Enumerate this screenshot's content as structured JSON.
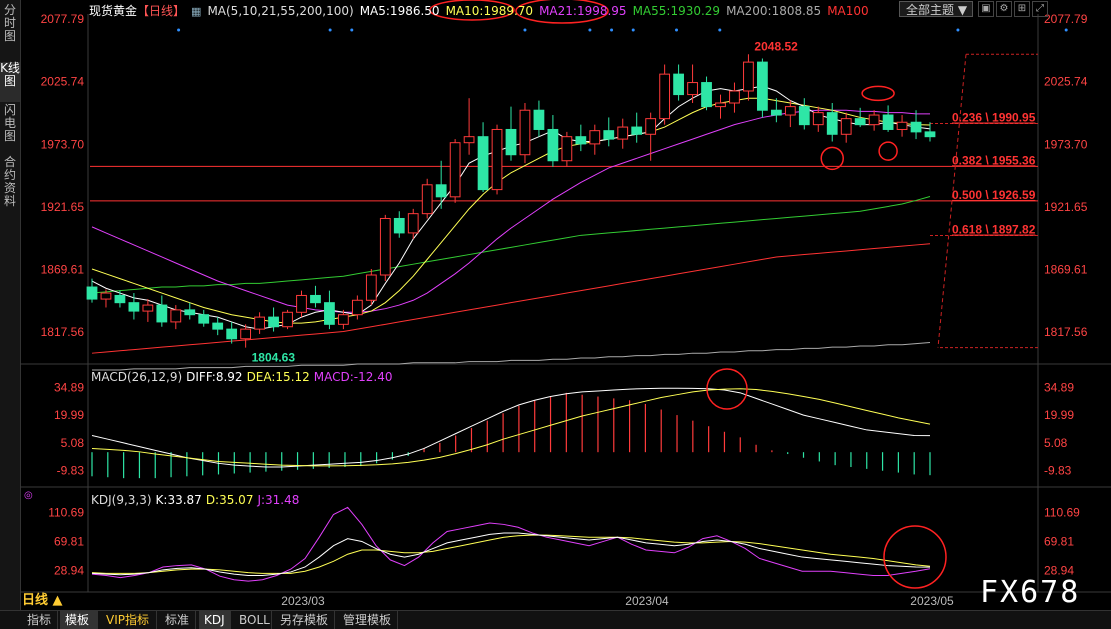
{
  "left_tabs": [
    "分时图",
    "K线图",
    "闪电图",
    "合约资料"
  ],
  "header": {
    "symbol": "现货黄金",
    "period_tag": "【日线】",
    "ma_params": "MA(5,10,21,55,200,100)",
    "ma5": "MA5:1986.50",
    "ma10": "MA10:1989.70",
    "ma21": "MA21:1998.95",
    "ma55": "MA55:1930.29",
    "ma200": "MA200:1808.85",
    "ma100": "MA100",
    "theme": "全部主题"
  },
  "colors": {
    "up": "#ff3b3b",
    "down": "#2ee6a6",
    "ma5": "#ffffff",
    "ma10": "#ffff55",
    "ma21": "#e040fb",
    "ma55": "#33cc33",
    "ma200": "#aaaaaa",
    "ma100": "#ff3333",
    "axis_label": "#ff4444",
    "circle": "#ff2222"
  },
  "price_axis": [
    "2077.79",
    "2025.74",
    "1973.70",
    "1921.65",
    "1869.61",
    "1817.56"
  ],
  "price_annotations": {
    "high": "2048.52",
    "low": "1804.63"
  },
  "fib_levels": [
    {
      "label": "0.236 \\ 1990.95",
      "price": 1990.95
    },
    {
      "label": "0.382 \\ 1955.36",
      "price": 1955.36
    },
    {
      "label": "0.500 \\ 1926.59",
      "price": 1926.59
    },
    {
      "label": "0.618 \\ 1897.82",
      "price": 1897.82
    }
  ],
  "macd": {
    "params": "MACD(26,12,9)",
    "diff": "DIFF:8.92",
    "dea": "DEA:15.12",
    "macd": "MACD:-12.40",
    "axis": [
      "34.89",
      "19.99",
      "5.08",
      "-9.83"
    ],
    "hist": [
      -13,
      -13.5,
      -14,
      -14,
      -14,
      -13.5,
      -13,
      -12.5,
      -12,
      -11.5,
      -11,
      -10.5,
      -10,
      -9.5,
      -9,
      -8.5,
      -8,
      -7.5,
      -6,
      -4,
      -2,
      2,
      5,
      9,
      13,
      17,
      21,
      25,
      28,
      30,
      32,
      31,
      30,
      29,
      28,
      26,
      23,
      20,
      17,
      14,
      11,
      8,
      4,
      1,
      -1,
      -3,
      -5,
      -7,
      -8,
      -9,
      -10,
      -11,
      -12,
      -12.4
    ],
    "diff_line": [
      9,
      7,
      5,
      3,
      1,
      -1,
      -3,
      -4.5,
      -6,
      -7,
      -7.5,
      -8,
      -8,
      -7.5,
      -7,
      -6.5,
      -6,
      -5.5,
      -4.5,
      -3,
      -1,
      2,
      6,
      10,
      14,
      18,
      22,
      25.5,
      28,
      30,
      31.5,
      32.5,
      33,
      33.5,
      34,
      34.3,
      34.5,
      34.5,
      34.4,
      34.2,
      33.5,
      32,
      29,
      26,
      23,
      20,
      18,
      16,
      14,
      12,
      11,
      10,
      9,
      8.92
    ],
    "dea_line": [
      2,
      1.5,
      1,
      0.2,
      -1,
      -2,
      -3,
      -4,
      -5,
      -5.5,
      -6,
      -6.5,
      -7,
      -7.2,
      -7.4,
      -7.4,
      -7.3,
      -7.1,
      -6.8,
      -6.3,
      -5.5,
      -4.3,
      -2.8,
      -0.8,
      1.5,
      4,
      7,
      9.5,
      12,
      14.5,
      17,
      19.5,
      21.5,
      23.5,
      25.5,
      27.5,
      29.5,
      31,
      32.5,
      33.5,
      34,
      34.2,
      33.8,
      32.8,
      31.5,
      30,
      28.5,
      26.5,
      24.5,
      22.5,
      20.5,
      18.5,
      16.8,
      15.12
    ]
  },
  "kdj": {
    "params": "KDJ(9,3,3)",
    "k": "K:33.87",
    "d": "D:35.07",
    "j": "J:31.48",
    "axis": [
      "110.69",
      "69.81",
      "28.94"
    ],
    "k_line": [
      25,
      24,
      23,
      24,
      26,
      30,
      32,
      33,
      31,
      27,
      24,
      22,
      22,
      24,
      27,
      34,
      48,
      64,
      74,
      70,
      60,
      52,
      48,
      52,
      60,
      68,
      72,
      76,
      80,
      82,
      82,
      80,
      78,
      76,
      74,
      72,
      74,
      76,
      72,
      68,
      66,
      64,
      66,
      70,
      72,
      70,
      66,
      60,
      56,
      52,
      48,
      46,
      44,
      42,
      40,
      38,
      36,
      35,
      34,
      33.87
    ],
    "d_line": [
      26,
      25,
      25,
      25,
      26,
      28,
      30,
      31,
      31,
      30,
      28,
      26,
      25,
      25,
      25,
      28,
      34,
      42,
      52,
      58,
      58,
      56,
      54,
      54,
      56,
      60,
      64,
      68,
      72,
      76,
      78,
      79,
      79,
      78,
      77,
      76,
      76,
      76,
      75,
      73,
      71,
      69,
      68,
      68,
      69,
      70,
      69,
      67,
      64,
      61,
      58,
      55,
      52,
      50,
      48,
      46,
      43,
      40,
      37,
      35.07
    ],
    "j_line": [
      24,
      22,
      19,
      22,
      26,
      34,
      36,
      37,
      31,
      21,
      16,
      14,
      16,
      22,
      31,
      46,
      76,
      108,
      118,
      94,
      64,
      44,
      36,
      48,
      68,
      84,
      88,
      92,
      96,
      94,
      90,
      82,
      76,
      72,
      68,
      64,
      70,
      76,
      66,
      58,
      56,
      54,
      62,
      74,
      78,
      70,
      60,
      46,
      40,
      34,
      28,
      28,
      28,
      26,
      24,
      22,
      22,
      25,
      28,
      31.48
    ]
  },
  "time_axis": [
    "2023/03",
    "2023/04",
    "2023/05"
  ],
  "period_label": "日线 ▲",
  "bottom_tabs": [
    "指标",
    "模板",
    "VIP指标",
    "标准",
    "KDJ",
    "BOLL",
    "另存模板",
    "管理模板"
  ],
  "watermark": "FX678",
  "chart_data": {
    "type": "candlestick",
    "ylim": [
      1796,
      2082
    ],
    "ohlc": [
      [
        1855,
        1862,
        1842,
        1845
      ],
      [
        1845,
        1853,
        1838,
        1850
      ],
      [
        1848,
        1852,
        1838,
        1842
      ],
      [
        1842,
        1850,
        1828,
        1835
      ],
      [
        1835,
        1845,
        1826,
        1840
      ],
      [
        1840,
        1848,
        1822,
        1826
      ],
      [
        1826,
        1840,
        1820,
        1836
      ],
      [
        1836,
        1842,
        1828,
        1832
      ],
      [
        1832,
        1836,
        1822,
        1825
      ],
      [
        1825,
        1830,
        1815,
        1820
      ],
      [
        1820,
        1826,
        1808,
        1812
      ],
      [
        1812,
        1824,
        1804.63,
        1820
      ],
      [
        1820,
        1834,
        1816,
        1830
      ],
      [
        1830,
        1838,
        1818,
        1822
      ],
      [
        1822,
        1836,
        1820,
        1834
      ],
      [
        1834,
        1852,
        1830,
        1848
      ],
      [
        1848,
        1856,
        1838,
        1842
      ],
      [
        1842,
        1852,
        1820,
        1824
      ],
      [
        1824,
        1836,
        1820,
        1832
      ],
      [
        1832,
        1848,
        1828,
        1844
      ],
      [
        1844,
        1870,
        1840,
        1865
      ],
      [
        1865,
        1915,
        1860,
        1912
      ],
      [
        1912,
        1918,
        1896,
        1900
      ],
      [
        1900,
        1920,
        1895,
        1916
      ],
      [
        1916,
        1945,
        1912,
        1940
      ],
      [
        1940,
        1960,
        1920,
        1930
      ],
      [
        1930,
        1978,
        1925,
        1975
      ],
      [
        1975,
        2012,
        1965,
        1980
      ],
      [
        1980,
        1992,
        1934,
        1936
      ],
      [
        1936,
        1990,
        1932,
        1986
      ],
      [
        1986,
        2005,
        1960,
        1965
      ],
      [
        1965,
        2008,
        1958,
        2002
      ],
      [
        2002,
        2010,
        1980,
        1986
      ],
      [
        1986,
        1998,
        1955,
        1960
      ],
      [
        1960,
        1984,
        1955,
        1980
      ],
      [
        1980,
        1990,
        1968,
        1974
      ],
      [
        1974,
        1990,
        1965,
        1985
      ],
      [
        1985,
        1996,
        1972,
        1978
      ],
      [
        1978,
        1995,
        1970,
        1988
      ],
      [
        1988,
        2000,
        1975,
        1982
      ],
      [
        1982,
        2000,
        1960,
        1995
      ],
      [
        1995,
        2040,
        1990,
        2032
      ],
      [
        2032,
        2040,
        2010,
        2015
      ],
      [
        2015,
        2040,
        2008,
        2025
      ],
      [
        2025,
        2030,
        2002,
        2005
      ],
      [
        2005,
        2015,
        1995,
        2008
      ],
      [
        2008,
        2025,
        2000,
        2018
      ],
      [
        2018,
        2048.52,
        2010,
        2042
      ],
      [
        2042,
        2045,
        1996,
        2002
      ],
      [
        2002,
        2012,
        1992,
        1998
      ],
      [
        1998,
        2010,
        1988,
        2005
      ],
      [
        2005,
        2012,
        1986,
        1990
      ],
      [
        1990,
        2005,
        1984,
        2000
      ],
      [
        2000,
        2008,
        1976,
        1982
      ],
      [
        1982,
        2000,
        1975,
        1995
      ],
      [
        1995,
        2004,
        1988,
        1990
      ],
      [
        1990,
        2002,
        1985,
        1998
      ],
      [
        1998,
        2006,
        1984,
        1986
      ],
      [
        1986,
        1998,
        1980,
        1992
      ],
      [
        1992,
        2002,
        1978,
        1984
      ],
      [
        1984,
        1992,
        1976,
        1980
      ]
    ],
    "ma5": [
      1860,
      1854,
      1850,
      1846,
      1844,
      1840,
      1836,
      1834,
      1832,
      1830,
      1826,
      1822,
      1820,
      1822,
      1824,
      1830,
      1834,
      1836,
      1834,
      1832,
      1840,
      1858,
      1875,
      1895,
      1910,
      1925,
      1940,
      1958,
      1964,
      1968,
      1972,
      1975,
      1980,
      1985,
      1978,
      1976,
      1976,
      1978,
      1980,
      1982,
      1984,
      1995,
      2005,
      2012,
      2018,
      2020,
      2018,
      2020,
      2022,
      2018,
      2010,
      2005,
      1998,
      1995,
      1992,
      1990,
      1990,
      1992,
      1990,
      1988,
      1986.5
    ],
    "ma10": [
      1870,
      1866,
      1862,
      1858,
      1854,
      1850,
      1846,
      1842,
      1838,
      1835,
      1832,
      1830,
      1828,
      1826,
      1825,
      1825,
      1826,
      1828,
      1830,
      1832,
      1835,
      1842,
      1852,
      1864,
      1878,
      1892,
      1906,
      1920,
      1932,
      1942,
      1950,
      1956,
      1962,
      1968,
      1972,
      1974,
      1976,
      1978,
      1980,
      1982,
      1984,
      1988,
      1994,
      2000,
      2005,
      2008,
      2010,
      2012,
      2012,
      2010,
      2008,
      2006,
      2004,
      2002,
      1999,
      1996,
      1994,
      1992,
      1991,
      1990,
      1989.7
    ],
    "ma21": [
      1905,
      1900,
      1895,
      1890,
      1885,
      1880,
      1875,
      1870,
      1865,
      1860,
      1856,
      1852,
      1848,
      1844,
      1840,
      1838,
      1836,
      1835,
      1834,
      1834,
      1835,
      1837,
      1840,
      1844,
      1850,
      1858,
      1866,
      1875,
      1885,
      1895,
      1904,
      1912,
      1920,
      1928,
      1935,
      1942,
      1948,
      1954,
      1958,
      1962,
      1966,
      1970,
      1974,
      1978,
      1982,
      1986,
      1990,
      1993,
      1996,
      1998,
      2000,
      2001,
      2002,
      2002,
      2002,
      2001,
      2001,
      2000,
      2000,
      1999,
      1998.95
    ],
    "ma55": [
      1850,
      1851,
      1852,
      1853,
      1854,
      1855,
      1855,
      1856,
      1856,
      1857,
      1857,
      1858,
      1858,
      1859,
      1860,
      1861,
      1862,
      1863,
      1864,
      1866,
      1868,
      1870,
      1872,
      1874,
      1876,
      1878,
      1880,
      1882,
      1884,
      1886,
      1888,
      1890,
      1892,
      1894,
      1896,
      1898,
      1899,
      1900,
      1901,
      1902,
      1903,
      1904,
      1905,
      1906,
      1907,
      1908,
      1909,
      1910,
      1911,
      1912,
      1913,
      1914,
      1915,
      1916,
      1917,
      1918,
      1920,
      1922,
      1924,
      1927,
      1930.29
    ],
    "ma100": [
      1800,
      1801,
      1802,
      1803,
      1804,
      1805,
      1806,
      1807,
      1808,
      1809,
      1810,
      1811,
      1812,
      1813,
      1814,
      1815,
      1816,
      1817,
      1818,
      1820,
      1822,
      1824,
      1826,
      1828,
      1830,
      1832,
      1834,
      1836,
      1838,
      1840,
      1842,
      1844,
      1846,
      1848,
      1850,
      1852,
      1854,
      1856,
      1858,
      1860,
      1862,
      1864,
      1866,
      1868,
      1870,
      1872,
      1874,
      1876,
      1878,
      1880,
      1881,
      1882,
      1883,
      1884,
      1885,
      1886,
      1887,
      1888,
      1889,
      1890,
      1891
    ],
    "ma200": [
      1786,
      1786,
      1786,
      1787,
      1787,
      1787,
      1787,
      1788,
      1788,
      1788,
      1788,
      1789,
      1789,
      1789,
      1789,
      1790,
      1790,
      1790,
      1790,
      1791,
      1791,
      1791,
      1791,
      1792,
      1792,
      1792,
      1792,
      1793,
      1793,
      1793,
      1794,
      1794,
      1794,
      1795,
      1795,
      1796,
      1796,
      1797,
      1797,
      1798,
      1798,
      1799,
      1799,
      1800,
      1800,
      1801,
      1801,
      1802,
      1802,
      1803,
      1803,
      1804,
      1804,
      1805,
      1805,
      1806,
      1806,
      1807,
      1807,
      1808,
      1808.85
    ]
  }
}
